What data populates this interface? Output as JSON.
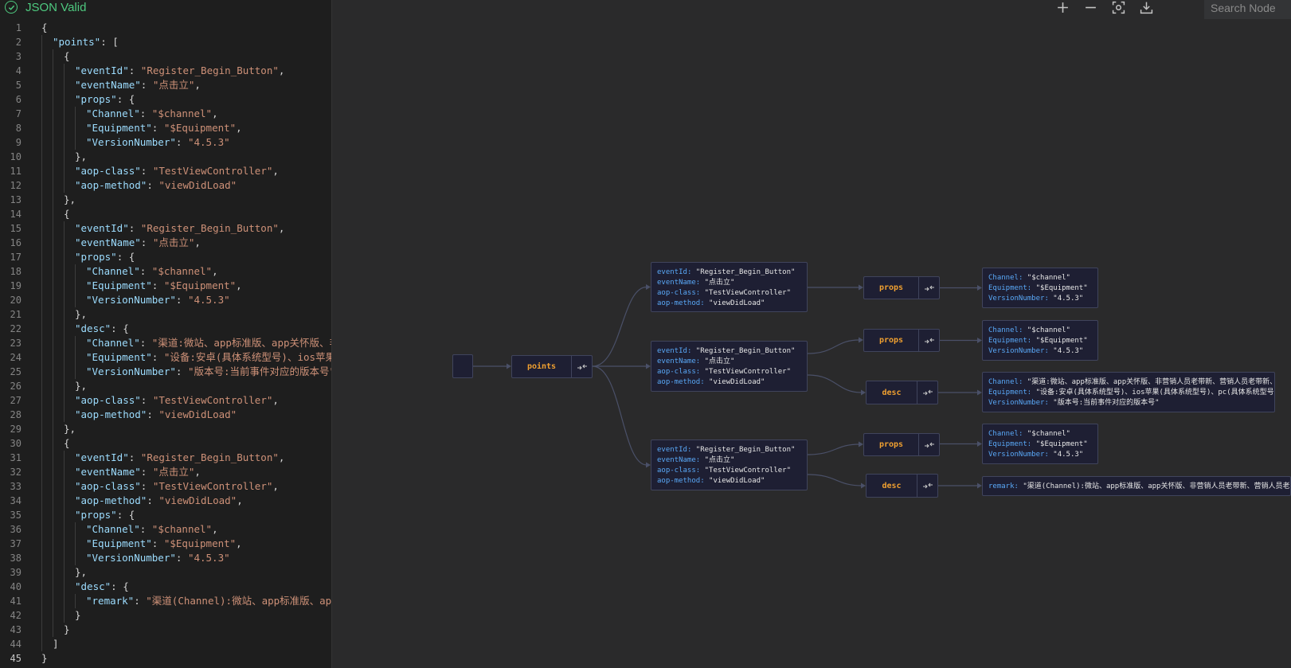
{
  "status": {
    "label": "JSON Valid"
  },
  "editor": {
    "lines": [
      [
        {
          "t": "p",
          "v": "{"
        }
      ],
      [
        {
          "t": "k",
          "v": "\"points\""
        },
        {
          "t": "p",
          "v": ": ["
        }
      ],
      [
        {
          "t": "p",
          "v": "{"
        }
      ],
      [
        {
          "t": "k",
          "v": "\"eventId\""
        },
        {
          "t": "p",
          "v": ": "
        },
        {
          "t": "s",
          "v": "\"Register_Begin_Button\""
        },
        {
          "t": "p",
          "v": ","
        }
      ],
      [
        {
          "t": "k",
          "v": "\"eventName\""
        },
        {
          "t": "p",
          "v": ": "
        },
        {
          "t": "s",
          "v": "\"点击立\""
        },
        {
          "t": "p",
          "v": ","
        }
      ],
      [
        {
          "t": "k",
          "v": "\"props\""
        },
        {
          "t": "p",
          "v": ": {"
        }
      ],
      [
        {
          "t": "k",
          "v": "\"Channel\""
        },
        {
          "t": "p",
          "v": ": "
        },
        {
          "t": "s",
          "v": "\"$channel\""
        },
        {
          "t": "p",
          "v": ","
        }
      ],
      [
        {
          "t": "k",
          "v": "\"Equipment\""
        },
        {
          "t": "p",
          "v": ": "
        },
        {
          "t": "s",
          "v": "\"$Equipment\""
        },
        {
          "t": "p",
          "v": ","
        }
      ],
      [
        {
          "t": "k",
          "v": "\"VersionNumber\""
        },
        {
          "t": "p",
          "v": ": "
        },
        {
          "t": "s",
          "v": "\"4.5.3\""
        }
      ],
      [
        {
          "t": "p",
          "v": "},"
        }
      ],
      [
        {
          "t": "k",
          "v": "\"aop-class\""
        },
        {
          "t": "p",
          "v": ": "
        },
        {
          "t": "s",
          "v": "\"TestViewController\""
        },
        {
          "t": "p",
          "v": ","
        }
      ],
      [
        {
          "t": "k",
          "v": "\"aop-method\""
        },
        {
          "t": "p",
          "v": ": "
        },
        {
          "t": "s",
          "v": "\"viewDidLoad\""
        }
      ],
      [
        {
          "t": "p",
          "v": "},"
        }
      ],
      [
        {
          "t": "p",
          "v": "{"
        }
      ],
      [
        {
          "t": "k",
          "v": "\"eventId\""
        },
        {
          "t": "p",
          "v": ": "
        },
        {
          "t": "s",
          "v": "\"Register_Begin_Button\""
        },
        {
          "t": "p",
          "v": ","
        }
      ],
      [
        {
          "t": "k",
          "v": "\"eventName\""
        },
        {
          "t": "p",
          "v": ": "
        },
        {
          "t": "s",
          "v": "\"点击立\""
        },
        {
          "t": "p",
          "v": ","
        }
      ],
      [
        {
          "t": "k",
          "v": "\"props\""
        },
        {
          "t": "p",
          "v": ": {"
        }
      ],
      [
        {
          "t": "k",
          "v": "\"Channel\""
        },
        {
          "t": "p",
          "v": ": "
        },
        {
          "t": "s",
          "v": "\"$channel\""
        },
        {
          "t": "p",
          "v": ","
        }
      ],
      [
        {
          "t": "k",
          "v": "\"Equipment\""
        },
        {
          "t": "p",
          "v": ": "
        },
        {
          "t": "s",
          "v": "\"$Equipment\""
        },
        {
          "t": "p",
          "v": ","
        }
      ],
      [
        {
          "t": "k",
          "v": "\"VersionNumber\""
        },
        {
          "t": "p",
          "v": ": "
        },
        {
          "t": "s",
          "v": "\"4.5.3\""
        }
      ],
      [
        {
          "t": "p",
          "v": "},"
        }
      ],
      [
        {
          "t": "k",
          "v": "\"desc\""
        },
        {
          "t": "p",
          "v": ": {"
        }
      ],
      [
        {
          "t": "k",
          "v": "\"Channel\""
        },
        {
          "t": "p",
          "v": ": "
        },
        {
          "t": "s",
          "v": "\"渠道:微站、app标准版、app关怀版、非"
        }
      ],
      [
        {
          "t": "k",
          "v": "\"Equipment\""
        },
        {
          "t": "p",
          "v": ": "
        },
        {
          "t": "s",
          "v": "\"设备:安卓(具体系统型号)、ios苹果("
        }
      ],
      [
        {
          "t": "k",
          "v": "\"VersionNumber\""
        },
        {
          "t": "p",
          "v": ": "
        },
        {
          "t": "s",
          "v": "\"版本号:当前事件对应的版本号\""
        }
      ],
      [
        {
          "t": "p",
          "v": "},"
        }
      ],
      [
        {
          "t": "k",
          "v": "\"aop-class\""
        },
        {
          "t": "p",
          "v": ": "
        },
        {
          "t": "s",
          "v": "\"TestViewController\""
        },
        {
          "t": "p",
          "v": ","
        }
      ],
      [
        {
          "t": "k",
          "v": "\"aop-method\""
        },
        {
          "t": "p",
          "v": ": "
        },
        {
          "t": "s",
          "v": "\"viewDidLoad\""
        }
      ],
      [
        {
          "t": "p",
          "v": "},"
        }
      ],
      [
        {
          "t": "p",
          "v": "{"
        }
      ],
      [
        {
          "t": "k",
          "v": "\"eventId\""
        },
        {
          "t": "p",
          "v": ": "
        },
        {
          "t": "s",
          "v": "\"Register_Begin_Button\""
        },
        {
          "t": "p",
          "v": ","
        }
      ],
      [
        {
          "t": "k",
          "v": "\"eventName\""
        },
        {
          "t": "p",
          "v": ": "
        },
        {
          "t": "s",
          "v": "\"点击立\""
        },
        {
          "t": "p",
          "v": ","
        }
      ],
      [
        {
          "t": "k",
          "v": "\"aop-class\""
        },
        {
          "t": "p",
          "v": ": "
        },
        {
          "t": "s",
          "v": "\"TestViewController\""
        },
        {
          "t": "p",
          "v": ","
        }
      ],
      [
        {
          "t": "k",
          "v": "\"aop-method\""
        },
        {
          "t": "p",
          "v": ": "
        },
        {
          "t": "s",
          "v": "\"viewDidLoad\""
        },
        {
          "t": "p",
          "v": ","
        }
      ],
      [
        {
          "t": "k",
          "v": "\"props\""
        },
        {
          "t": "p",
          "v": ": {"
        }
      ],
      [
        {
          "t": "k",
          "v": "\"Channel\""
        },
        {
          "t": "p",
          "v": ": "
        },
        {
          "t": "s",
          "v": "\"$channel\""
        },
        {
          "t": "p",
          "v": ","
        }
      ],
      [
        {
          "t": "k",
          "v": "\"Equipment\""
        },
        {
          "t": "p",
          "v": ": "
        },
        {
          "t": "s",
          "v": "\"$Equipment\""
        },
        {
          "t": "p",
          "v": ","
        }
      ],
      [
        {
          "t": "k",
          "v": "\"VersionNumber\""
        },
        {
          "t": "p",
          "v": ": "
        },
        {
          "t": "s",
          "v": "\"4.5.3\""
        }
      ],
      [
        {
          "t": "p",
          "v": "},"
        }
      ],
      [
        {
          "t": "k",
          "v": "\"desc\""
        },
        {
          "t": "p",
          "v": ": {"
        }
      ],
      [
        {
          "t": "k",
          "v": "\"remark\""
        },
        {
          "t": "p",
          "v": ": "
        },
        {
          "t": "s",
          "v": "\"渠道(Channel):微站、app标准版、app"
        }
      ],
      [
        {
          "t": "p",
          "v": "}"
        }
      ],
      [
        {
          "t": "p",
          "v": "}"
        }
      ],
      [
        {
          "t": "p",
          "v": "]"
        }
      ],
      [
        {
          "t": "p",
          "v": "}"
        }
      ]
    ],
    "active_line": 45
  },
  "toolbar": {
    "icons": [
      "plus-icon",
      "minus-icon",
      "focus-icon",
      "download-icon"
    ],
    "search_placeholder": "Search Node"
  },
  "graph": {
    "points_label": "points",
    "objects": [
      [
        [
          "eventId",
          "\"Register_Begin_Button\""
        ],
        [
          "eventName",
          "\"点击立\""
        ],
        [
          "aop-class",
          "\"TestViewController\""
        ],
        [
          "aop-method",
          "\"viewDidLoad\""
        ]
      ],
      [
        [
          "eventId",
          "\"Register_Begin_Button\""
        ],
        [
          "eventName",
          "\"点击立\""
        ],
        [
          "aop-class",
          "\"TestViewController\""
        ],
        [
          "aop-method",
          "\"viewDidLoad\""
        ]
      ],
      [
        [
          "eventId",
          "\"Register_Begin_Button\""
        ],
        [
          "eventName",
          "\"点击立\""
        ],
        [
          "aop-class",
          "\"TestViewController\""
        ],
        [
          "aop-method",
          "\"viewDidLoad\""
        ]
      ]
    ],
    "props_label": "props",
    "desc_label": "desc",
    "props_values": [
      [
        [
          "Channel",
          "\"$channel\""
        ],
        [
          "Equipment",
          "\"$Equipment\""
        ],
        [
          "VersionNumber",
          "\"4.5.3\""
        ]
      ],
      [
        [
          "Channel",
          "\"$channel\""
        ],
        [
          "Equipment",
          "\"$Equipment\""
        ],
        [
          "VersionNumber",
          "\"4.5.3\""
        ]
      ],
      [
        [
          "Channel",
          "\"$channel\""
        ],
        [
          "Equipment",
          "\"$Equipment\""
        ],
        [
          "VersionNumber",
          "\"4.5.3\""
        ]
      ]
    ],
    "desc_values": [
      [
        [
          "Channel",
          "\"渠道:微站、app标准版、app关怀版、非营销人员老带新、营销人员老带新、…"
        ],
        [
          "Equipment",
          "\"设备:安卓(具体系统型号)、ios苹果(具体系统型号)、pc(具体系统型号)…"
        ],
        [
          "VersionNumber",
          "\"版本号:当前事件对应的版本号\""
        ]
      ],
      [
        [
          "remark",
          "\"渠道(Channel):微站、app标准版、app关怀版、非营销人员老带新、营销人员老带新、…"
        ]
      ]
    ]
  }
}
